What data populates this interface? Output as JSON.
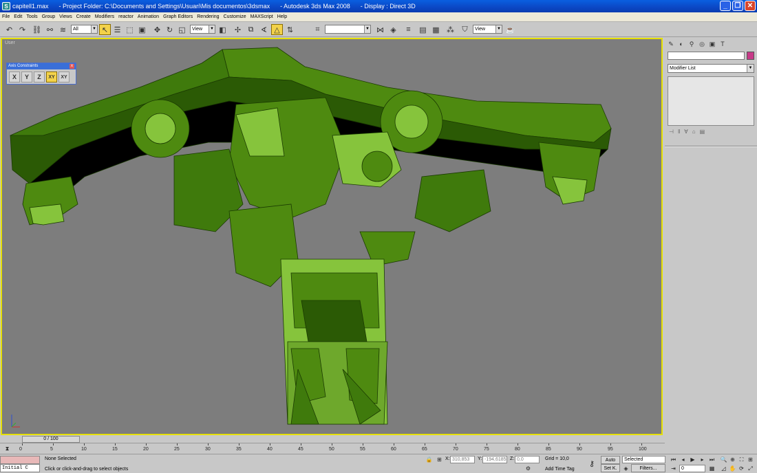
{
  "titlebar": {
    "title": "capitell1.max      - Project Folder: C:\\Documents and Settings\\Usuari\\Mis documentos\\3dsmax      - Autodesk 3ds Max 2008      - Display : Direct 3D",
    "minimize": "_",
    "maximize": "❐",
    "close": "✕"
  },
  "menu": [
    "File",
    "Edit",
    "Tools",
    "Group",
    "Views",
    "Create",
    "Modifiers",
    "reactor",
    "Animation",
    "Graph Editors",
    "Rendering",
    "Customize",
    "MAXScript",
    "Help"
  ],
  "toolbar": {
    "selection_filter": "All",
    "ref_coord": "View",
    "named_selection": "",
    "render_view": "View"
  },
  "viewport": {
    "label": "User",
    "mesh_colors": {
      "dark": "#2b5a05",
      "mid": "#4e8a10",
      "light": "#86c43c",
      "edge": "#1a3a02"
    }
  },
  "axis_constraints": {
    "title": "Axis Constraints",
    "buttons": [
      "X",
      "Y",
      "Z",
      "XY",
      "XY"
    ]
  },
  "command_panel": {
    "tab_icons": [
      "create-icon",
      "modify-icon",
      "hierarchy-icon",
      "motion-icon",
      "display-icon",
      "utilities-icon"
    ],
    "modifier_list": "Modifier List",
    "object_color": "#c73a88"
  },
  "timeline": {
    "frame": "0 / 100",
    "ticks": [
      "0",
      "5",
      "10",
      "15",
      "20",
      "25",
      "30",
      "35",
      "40",
      "45",
      "50",
      "55",
      "60",
      "65",
      "70",
      "75",
      "80",
      "85",
      "90",
      "95",
      "100"
    ]
  },
  "status": {
    "maxscript": "Initial C",
    "selection": "None Selected",
    "prompt": "Click or click-and-drag to select objects",
    "x_label": "X:",
    "x": "310,853",
    "y_label": "Y:",
    "y": "-194,6185",
    "z_label": "Z:",
    "z": "0,0",
    "grid": "Grid = 10,0",
    "add_time_tag": "Add Time Tag",
    "auto": "Auto",
    "setk": "Set K.",
    "key_filter": "Selected",
    "filters": "Filters...",
    "frame": "0"
  }
}
